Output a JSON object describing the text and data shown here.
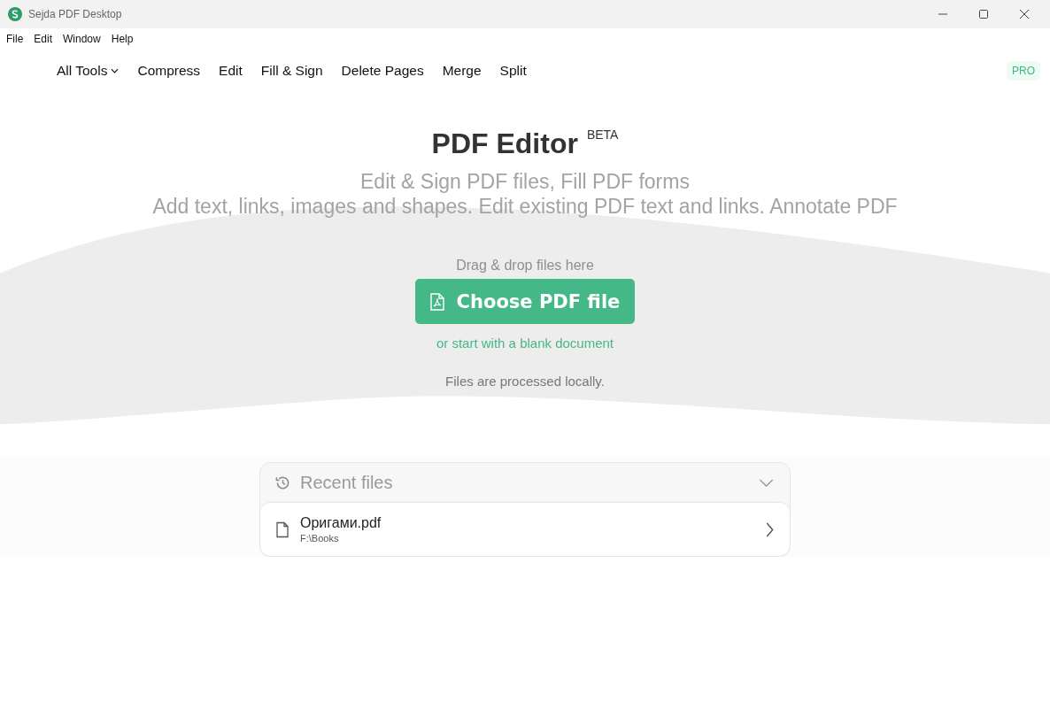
{
  "window": {
    "title": "Sejda PDF Desktop"
  },
  "menu": [
    "File",
    "Edit",
    "Window",
    "Help"
  ],
  "nav": [
    {
      "label": "All Tools",
      "kind": "dropdown"
    },
    {
      "label": "Compress",
      "kind": "link"
    },
    {
      "label": "Edit",
      "kind": "link"
    },
    {
      "label": "Fill & Sign",
      "kind": "link"
    },
    {
      "label": "Delete Pages",
      "kind": "link"
    },
    {
      "label": "Merge",
      "kind": "link"
    },
    {
      "label": "Split",
      "kind": "link"
    }
  ],
  "badge": "PRO",
  "hero": {
    "title": "PDF Editor",
    "tag": "BETA",
    "subtitle": "Edit & Sign PDF files, Fill PDF forms",
    "description": "Add text, links, images and shapes. Edit existing PDF text and links. Annotate PDF",
    "drop_hint": "Drag & drop files here",
    "button": "Choose PDF file",
    "blank_link": "or start with a blank document",
    "note": "Files are processed locally."
  },
  "recent": {
    "title": "Recent files",
    "expanded": true,
    "files": [
      {
        "name": "Оригами.pdf",
        "path": "F:\\Books"
      }
    ]
  }
}
